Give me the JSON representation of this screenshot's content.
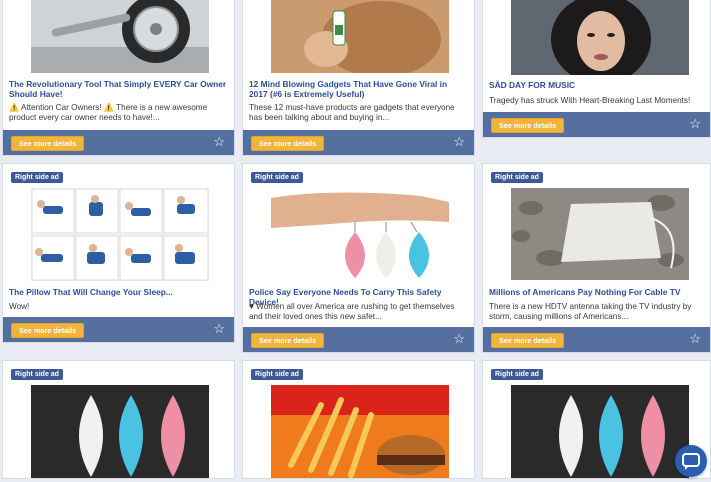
{
  "ad_badge": "Right side ad",
  "cta_label": "See more details",
  "star_icon": "☆",
  "cards": [
    {
      "title": "The Revolutionary Tool That Simply EVERY Car Owner Should Have!",
      "desc": "⚠️ Attention Car Owners! ⚠️ There is a new awesome product every car owner needs to have!..."
    },
    {
      "title": "12 Mind Blowing Gadgets That Have Gone Viral in 2017 (#6 is Extremely Useful)",
      "desc": "These 12 must-have products are gadgets that everyone has been talking about and buying in..."
    },
    {
      "title": "SĂD DAY FOR MUSIC",
      "desc": "Tragedy has struck With Heart-Breaking Last Moments!"
    },
    {
      "title": "The Pillow That Will Change Your Sleep...",
      "desc": "Wow!"
    },
    {
      "title": "Police Say Everyone Needs To Carry This Safety Device!",
      "desc": "♥ Women all over America are rushing to get themselves and their loved ones this new safet..."
    },
    {
      "title": "Millions of Americans Pay Nothing For Cable TV",
      "desc": "There is a new HDTV antenna taking the TV industry by storm, causing millions of Americans..."
    }
  ],
  "chat_icon": "chat-bubble-icon"
}
